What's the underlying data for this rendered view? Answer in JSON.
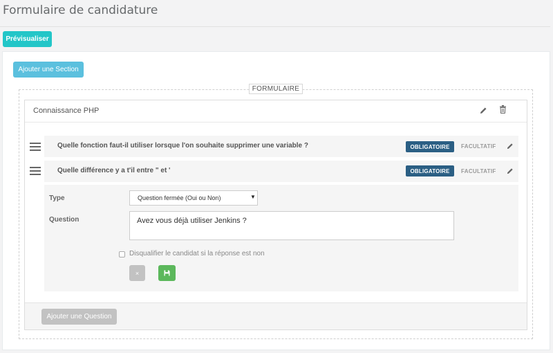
{
  "page": {
    "title": "Formulaire de candidature"
  },
  "toolbar": {
    "preview_label": "Prévisualiser"
  },
  "panel": {
    "add_section_label": "Ajouter une Section",
    "legend": "FORMULAIRE"
  },
  "section": {
    "title": "Connaissance PHP",
    "questions": [
      {
        "text": "Quelle fonction faut-il utiliser lorsque l'on souhaite supprimer une variable ?",
        "required_label": "OBLIGATOIRE",
        "optional_label": "FACULTATIF"
      },
      {
        "text": "Quelle différence y a t'il entre \" et '",
        "required_label": "OBLIGATOIRE",
        "optional_label": "FACULTATIF"
      }
    ],
    "editor": {
      "type_label": "Type",
      "type_value": "Question fermée (Oui ou Non)",
      "question_label": "Question",
      "question_value": "Avez vous déjà utiliser Jenkins ?",
      "disqualify_label": "Disqualifier le candidat si la réponse est non",
      "disqualify_checked": false,
      "cancel_glyph": "×"
    },
    "add_question_label": "Ajouter une Question"
  },
  "colors": {
    "preview": "#23c6c8",
    "add_section": "#5bc0de",
    "required_badge": "#2b5f84",
    "save": "#5cb85c",
    "neutral_button": "#c2c2c2"
  }
}
